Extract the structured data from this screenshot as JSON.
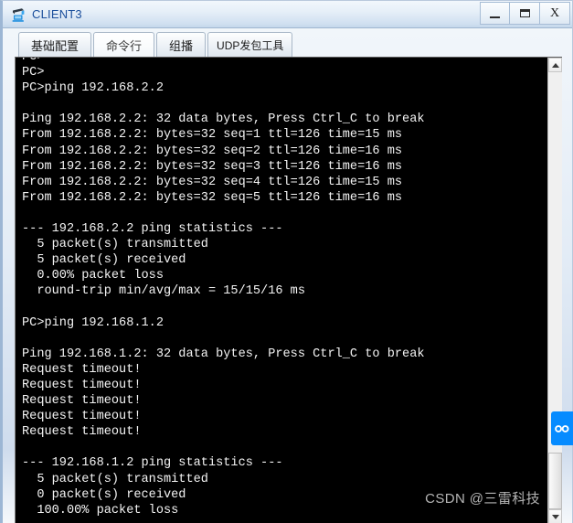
{
  "window": {
    "title": "CLIENT3",
    "icon": "client-pc-icon",
    "controls": {
      "minimize": "–",
      "maximize": "☐",
      "close": "X"
    }
  },
  "tabs": [
    {
      "label": "基础配置",
      "active": false
    },
    {
      "label": "命令行",
      "active": true
    },
    {
      "label": "组播",
      "active": false
    },
    {
      "label": "UDP发包工具",
      "active": false
    }
  ],
  "terminal": {
    "lines": [
      "PC>",
      "PC>",
      "PC>ping 192.168.2.2",
      "",
      "Ping 192.168.2.2: 32 data bytes, Press Ctrl_C to break",
      "From 192.168.2.2: bytes=32 seq=1 ttl=126 time=15 ms",
      "From 192.168.2.2: bytes=32 seq=2 ttl=126 time=16 ms",
      "From 192.168.2.2: bytes=32 seq=3 ttl=126 time=16 ms",
      "From 192.168.2.2: bytes=32 seq=4 ttl=126 time=15 ms",
      "From 192.168.2.2: bytes=32 seq=5 ttl=126 time=16 ms",
      "",
      "--- 192.168.2.2 ping statistics ---",
      "  5 packet(s) transmitted",
      "  5 packet(s) received",
      "  0.00% packet loss",
      "  round-trip min/avg/max = 15/15/16 ms",
      "",
      "PC>ping 192.168.1.2",
      "",
      "Ping 192.168.1.2: 32 data bytes, Press Ctrl_C to break",
      "Request timeout!",
      "Request timeout!",
      "Request timeout!",
      "Request timeout!",
      "Request timeout!",
      "",
      "--- 192.168.1.2 ping statistics ---",
      "  5 packet(s) transmitted",
      "  0 packet(s) received",
      "  100.00% packet loss"
    ]
  },
  "scrollbar": {
    "up_arrow": "scroll-up-arrow",
    "down_arrow": "scroll-down-arrow"
  },
  "badge": {
    "icon": "link-infinity-icon",
    "color": "#068bff"
  },
  "watermark": {
    "text": "CSDN @三雷科技"
  }
}
